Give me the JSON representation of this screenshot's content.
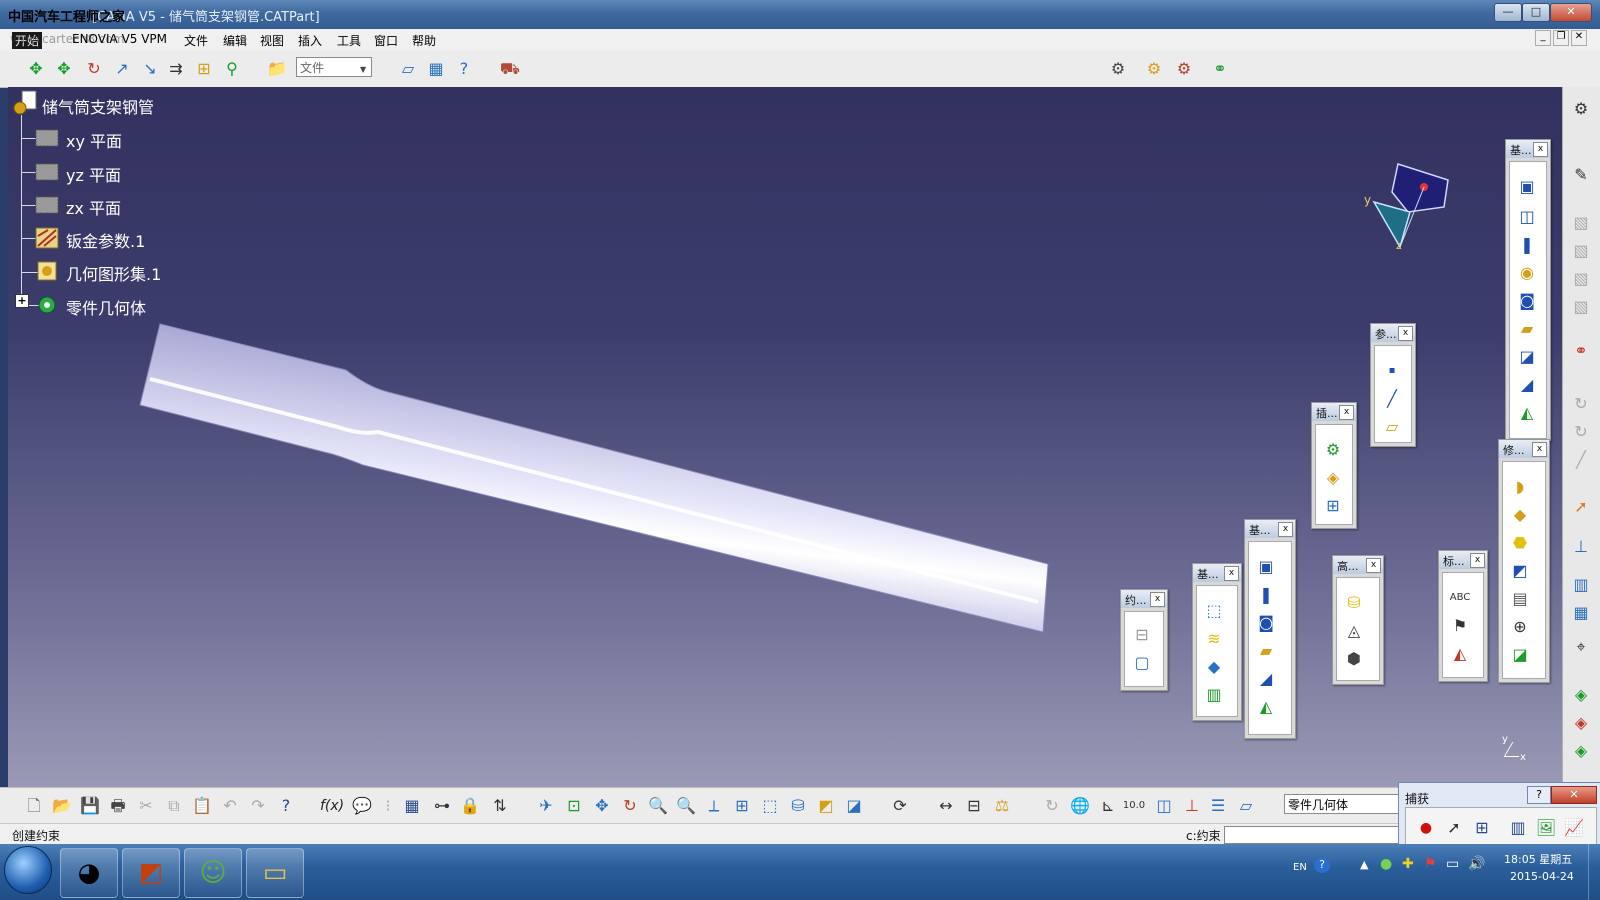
{
  "window": {
    "title": "[CATIA V5 - 储气筒支架钢管.CATPart]",
    "title_overlay": "中国汽车工程师之家",
    "min_label": "—",
    "max_label": "□",
    "close_label": "✕"
  },
  "menubar": {
    "watermark": "www.cartech8.com",
    "items": [
      "开始",
      "ENOVIA V5 VPM",
      "文件",
      "编辑",
      "视图",
      "插入",
      "工具",
      "窗口",
      "帮助"
    ],
    "doc_min": "_",
    "doc_restore": "❐",
    "doc_close": "✕"
  },
  "toolbar": {
    "file_combo": "文件"
  },
  "tree": {
    "root": "储气筒支架钢管",
    "items": [
      {
        "label": "xy 平面",
        "icon": "plane-icon"
      },
      {
        "label": "yz 平面",
        "icon": "plane-icon"
      },
      {
        "label": "zx 平面",
        "icon": "plane-icon"
      },
      {
        "label": "钣金参数.1",
        "icon": "sheetmetal-parameters-icon"
      },
      {
        "label": "几何图形集.1",
        "icon": "geometrical-set-icon"
      },
      {
        "label": "零件几何体",
        "icon": "part-body-icon"
      }
    ],
    "expand_symbol": "+"
  },
  "compass": {
    "y_label": "y",
    "z_label": "z",
    "x_label": "x"
  },
  "palettes": {
    "p1": "基...",
    "p2": "参...",
    "p3": "插...",
    "p4": "修...",
    "p5": "基...",
    "p6": "高...",
    "p7": "标...",
    "p8": "基...",
    "p9": "约...",
    "close": "x"
  },
  "bottom": {
    "current_body": "零件几何体",
    "status_text": "创建约束",
    "command_label": "c:约束",
    "command_value": ""
  },
  "snap_dialog": {
    "title": "捕获",
    "help": "?",
    "close": "✕"
  },
  "taskbar": {
    "lang": "EN",
    "time": "18:05 星期五",
    "date": "2015-04-24"
  },
  "colors": {
    "viewport_top": "#32315f",
    "viewport_bottom": "#9a9ab6",
    "tube": "#c7c7ea",
    "taskbar": "#2b5f9c"
  }
}
